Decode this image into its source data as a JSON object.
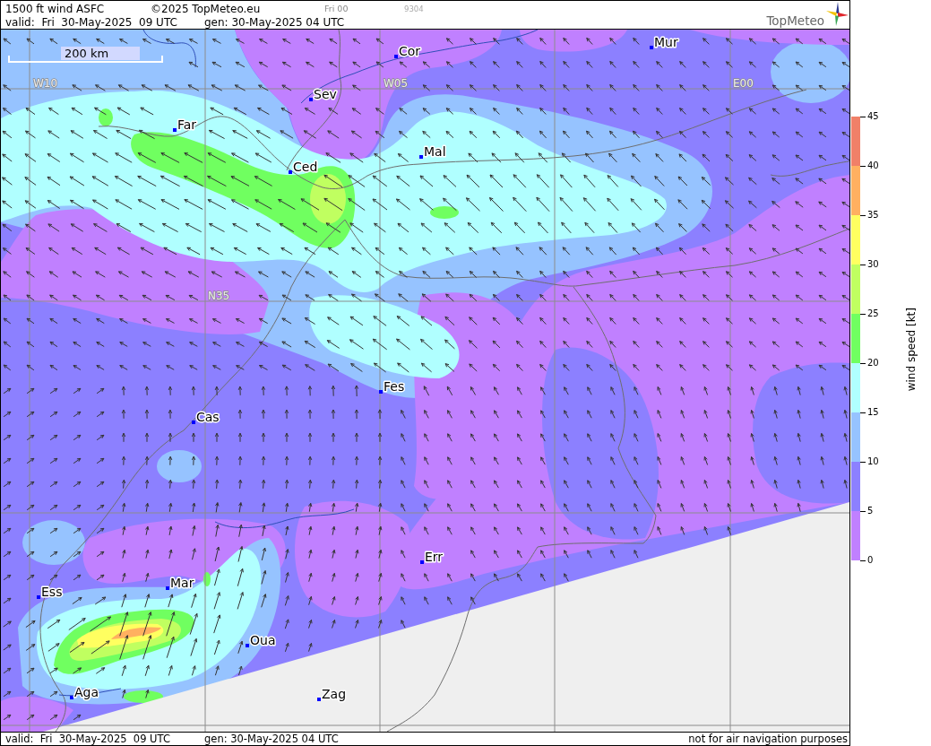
{
  "header": {
    "title": "1500 ft wind ASFC",
    "copyright": "©2025 TopMeteo.eu",
    "run": "Fri 00",
    "code": "9304",
    "valid": "valid:  Fri  30-May-2025  09 UTC",
    "generated": "gen: 30-May-2025 04 UTC",
    "logo": "TopMeteo"
  },
  "map": {
    "scale_label": "200 km",
    "grid_labels": [
      "W10",
      "W05",
      "E00",
      "N35"
    ],
    "cities": [
      "Mur",
      "Cor",
      "Sev",
      "Far",
      "Mal",
      "Ced",
      "Fes",
      "Cas",
      "Err",
      "Mar",
      "Ess",
      "Oua",
      "Aga",
      "Zag"
    ]
  },
  "legend": {
    "title": "wind speed [kt]",
    "ticks": [
      "45",
      "40",
      "35",
      "30",
      "25",
      "20",
      "15",
      "10",
      "5",
      "0"
    ],
    "bands": [
      {
        "color": "#f08068"
      },
      {
        "color": "#ffb060"
      },
      {
        "color": "#ffff60"
      },
      {
        "color": "#c0ff60"
      },
      {
        "color": "#70ff60"
      },
      {
        "color": "#b0ffff"
      },
      {
        "color": "#96c3ff"
      },
      {
        "color": "#8c80ff"
      },
      {
        "color": "#c080ff"
      }
    ]
  },
  "footer": {
    "valid": "valid:  Fri  30-May-2025  09 UTC",
    "generated": "gen: 30-May-2025 04 UTC",
    "disclaimer": "not for air navigation purposes"
  }
}
